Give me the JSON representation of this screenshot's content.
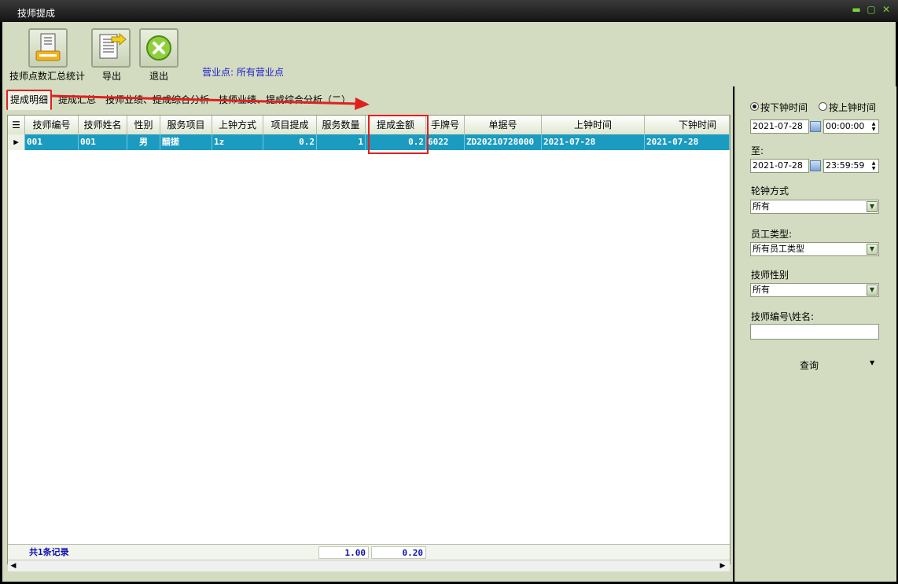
{
  "window": {
    "title": "技师提成"
  },
  "toolbar": {
    "buttons": [
      {
        "label": "技师点数汇总统计",
        "icon": "printer-summary-icon"
      },
      {
        "label": "导出",
        "icon": "export-document-icon"
      },
      {
        "label": "退出",
        "icon": "exit-x-icon"
      }
    ],
    "store_label": "营业点: 所有营业点"
  },
  "tabs": [
    "提成明细",
    "提成汇总",
    "技师业绩、提成综合分析",
    "技师业绩、提成综合分析（二）"
  ],
  "table": {
    "columns": [
      "技师编号",
      "技师姓名",
      "性别",
      "服务项目",
      "上钟方式",
      "项目提成",
      "服务数量",
      "提成金额",
      "手牌号",
      "单据号",
      "上钟时间",
      "下钟时间"
    ],
    "rows": [
      [
        "001",
        "001",
        "男",
        "醋搓",
        "1z",
        "0.2",
        "1",
        "0.2",
        "6022",
        "ZD20210728000",
        "2021-07-28",
        "2021-07-28"
      ]
    ],
    "footer": {
      "count": "共1条记录",
      "qty_total": "1.00",
      "amount_total": "0.20"
    }
  },
  "filters": {
    "radio_down": "按下钟时间",
    "radio_up": "按上钟时间",
    "radio_selected": "按下钟时间",
    "start_date": "2021-07-28",
    "start_time": "00:00:00",
    "to_label": "至:",
    "end_date": "2021-07-28",
    "end_time": "23:59:59",
    "shift_label": "轮钟方式",
    "shift_value": "所有",
    "emp_type_label": "员工类型:",
    "emp_type_value": "所有员工类型",
    "gender_label": "技师性别",
    "gender_value": "所有",
    "id_name_label": "技师编号\\姓名:",
    "id_name_value": "",
    "query_label": "查询"
  },
  "colors": {
    "accent_row": "#1b9bbf",
    "panel": "#d3dcc0",
    "annotation": "#e02020"
  }
}
